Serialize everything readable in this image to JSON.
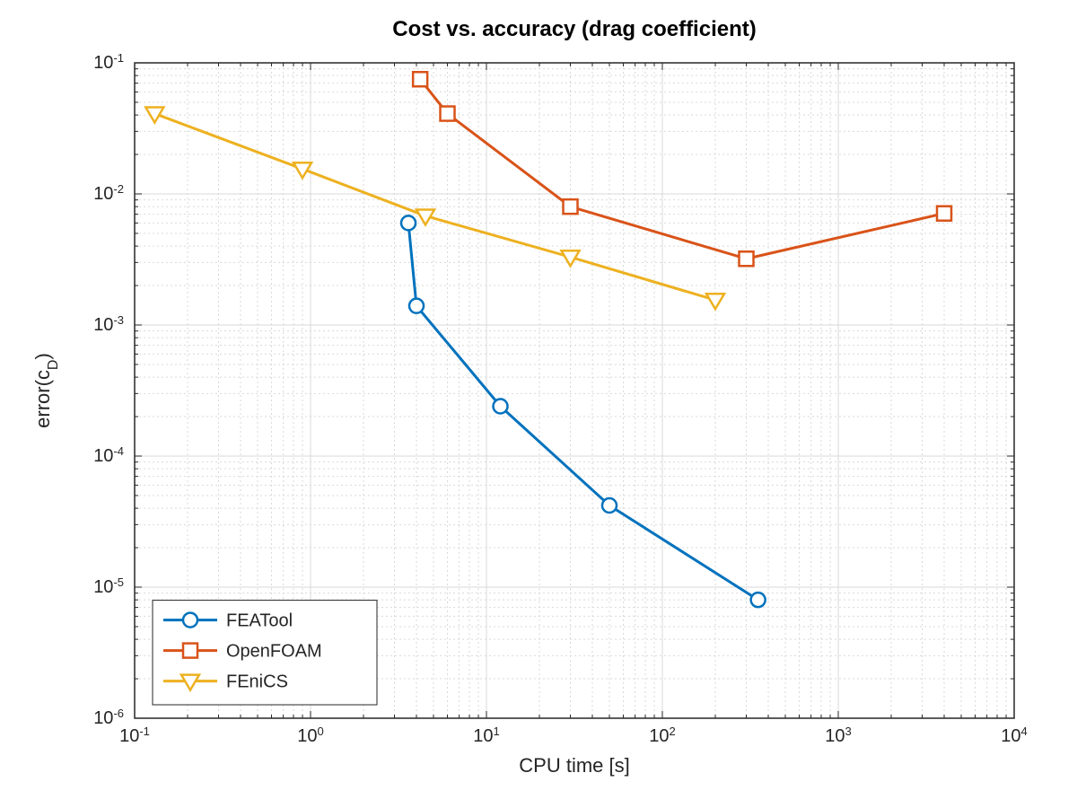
{
  "chart_data": {
    "type": "line",
    "title": "Cost vs. accuracy (drag coefficient)",
    "xlabel": "CPU time [s]",
    "ylabel": "error(c_D)",
    "xscale": "log",
    "yscale": "log",
    "xlim": [
      0.1,
      10000
    ],
    "ylim": [
      1e-06,
      0.1
    ],
    "grid": true,
    "legend_position": "lower-left",
    "colors": {
      "FEATool": "#0072BD",
      "OpenFOAM": "#D95319",
      "FEniCS": "#EDB120"
    },
    "markers": {
      "FEATool": "circle",
      "OpenFOAM": "square",
      "FEniCS": "triangle-down"
    },
    "series": [
      {
        "name": "FEATool",
        "x": [
          3.6,
          4,
          12,
          50,
          350
        ],
        "y": [
          0.006,
          0.0014,
          0.00024,
          4.2e-05,
          8e-06
        ]
      },
      {
        "name": "OpenFOAM",
        "x": [
          4.2,
          6,
          30,
          300,
          4000
        ],
        "y": [
          0.075,
          0.041,
          0.008,
          0.0032,
          0.0071
        ]
      },
      {
        "name": "FEniCS",
        "x": [
          0.13,
          0.9,
          4.5,
          30,
          200
        ],
        "y": [
          0.041,
          0.0155,
          0.0068,
          0.0033,
          0.00155
        ]
      }
    ],
    "xticks": [
      0.1,
      1,
      10,
      100,
      1000,
      10000
    ],
    "xtick_labels": [
      "10^-1",
      "10^0",
      "10^1",
      "10^2",
      "10^3",
      "10^4"
    ],
    "yticks": [
      1e-06,
      1e-05,
      0.0001,
      0.001,
      0.01,
      0.1
    ],
    "ytick_labels": [
      "10^-6",
      "10^-5",
      "10^-4",
      "10^-3",
      "10^-2",
      "10^-1"
    ]
  }
}
